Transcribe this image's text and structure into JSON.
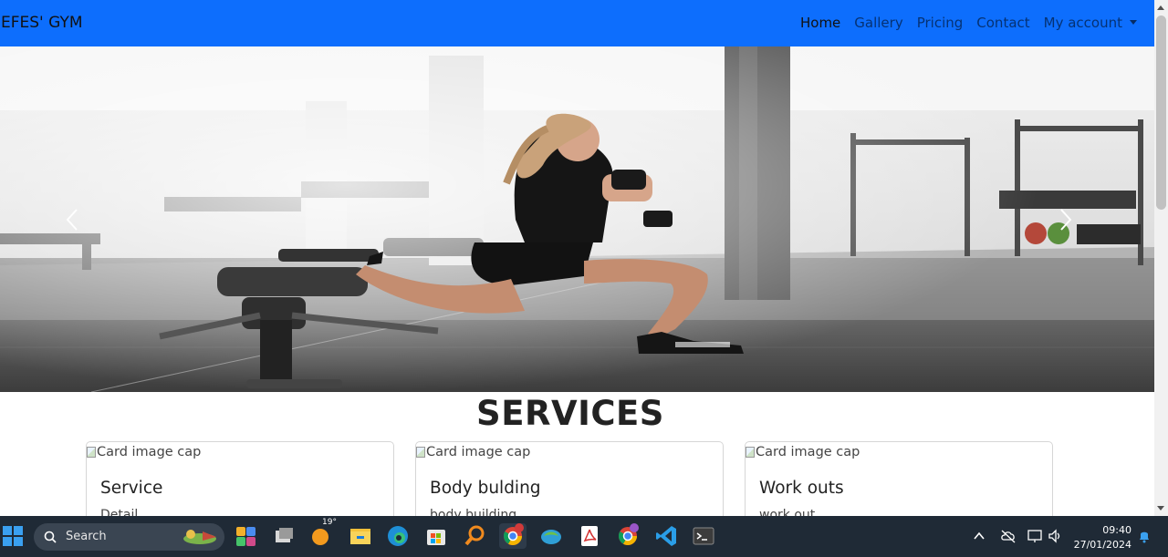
{
  "navbar": {
    "brand": "EFES' GYM",
    "links": [
      "Home",
      "Gallery",
      "Pricing",
      "Contact",
      "My account"
    ],
    "active_index": 0
  },
  "carousel": {
    "image": "woman doing dumbbell lunge in gym"
  },
  "services": {
    "title": "SERVICES",
    "cards": [
      {
        "img_alt": "Card image cap",
        "title": "Service",
        "text": "Detail"
      },
      {
        "img_alt": "Card image cap",
        "title": "Body bulding",
        "text": "body building"
      },
      {
        "img_alt": "Card image cap",
        "title": "Work outs",
        "text": "work out"
      }
    ]
  },
  "taskbar": {
    "search_placeholder": "Search",
    "weather_badge": "19°",
    "clock_time": "09:40",
    "clock_date": "27/01/2024",
    "apps": [
      "start-icon",
      "widgets-icon",
      "task-view-icon",
      "weather-icon",
      "file-explorer-icon",
      "edge-icon",
      "store-icon",
      "search-app-icon",
      "chrome-icon",
      "earth-icon",
      "pdf-icon",
      "chrome-profile-icon",
      "vscode-icon",
      "terminal-icon"
    ]
  },
  "colors": {
    "navbar": "#0d6efd",
    "taskbar": "#1f2a36"
  }
}
